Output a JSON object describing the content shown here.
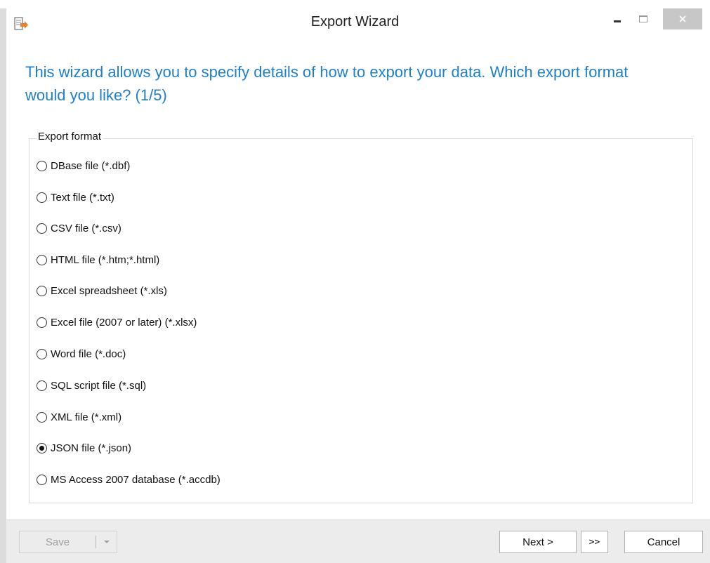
{
  "window": {
    "title": "Export Wizard",
    "controls": {
      "minimize_icon": "minimize-icon",
      "maximize_icon": "maximize-icon",
      "close_icon": "close-icon"
    },
    "app_icon": "export-icon"
  },
  "heading": "This wizard allows you to specify details of how to export your data. Which export format would you like? (1/5)",
  "export_format": {
    "group_label": "Export format",
    "selected_index": 9,
    "options": [
      {
        "label": "DBase file (*.dbf)",
        "checked": false
      },
      {
        "label": "Text file (*.txt)",
        "checked": false
      },
      {
        "label": "CSV file (*.csv)",
        "checked": false
      },
      {
        "label": "HTML file (*.htm;*.html)",
        "checked": false
      },
      {
        "label": "Excel spreadsheet (*.xls)",
        "checked": false
      },
      {
        "label": "Excel file (2007 or later) (*.xlsx)",
        "checked": false
      },
      {
        "label": "Word file (*.doc)",
        "checked": false
      },
      {
        "label": "SQL script file (*.sql)",
        "checked": false
      },
      {
        "label": "XML file (*.xml)",
        "checked": false
      },
      {
        "label": "JSON file (*.json)",
        "checked": true
      },
      {
        "label": "MS Access 2007 database (*.accdb)",
        "checked": false
      }
    ]
  },
  "footer": {
    "save_label": "Save",
    "save_enabled": false,
    "next_label": "Next >",
    "finish_label": ">>",
    "cancel_label": "Cancel"
  },
  "colors": {
    "heading": "#1f7fc9",
    "icon_accent": "#f07d28",
    "footer_bg": "#ececec"
  }
}
